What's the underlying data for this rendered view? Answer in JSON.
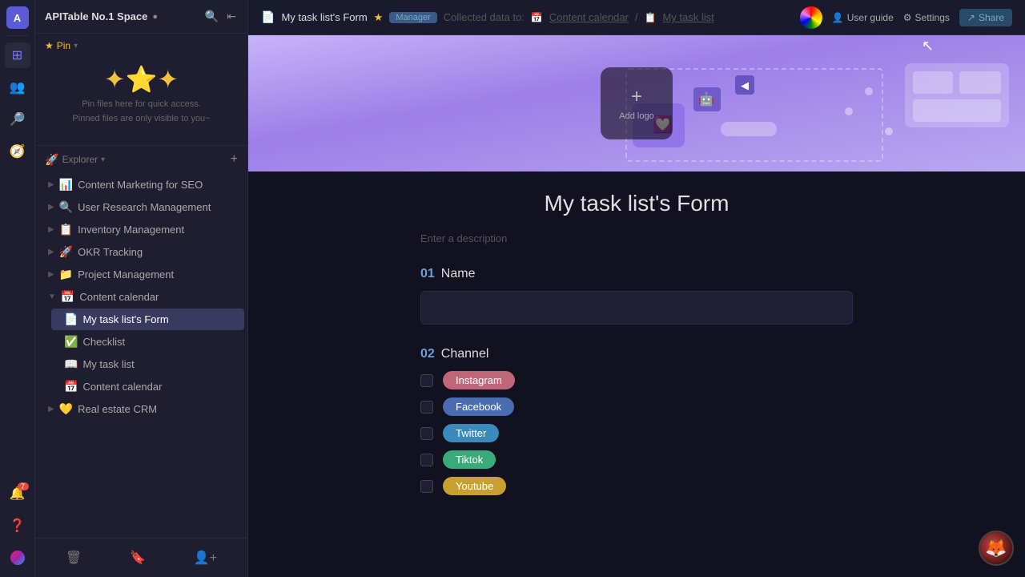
{
  "app": {
    "title": "APITable No.1 Space",
    "user_initial": "A"
  },
  "topbar": {
    "form_icon": "📄",
    "form_name": "My task list's Form",
    "star": "★",
    "badge": "Manager",
    "collected_label": "Collected data to:",
    "breadcrumb_separator": "/",
    "content_calendar_link": "Content calendar",
    "task_list_link": "My task list",
    "user_guide": "User guide",
    "settings": "Settings",
    "share": "Share"
  },
  "sidebar": {
    "title": "APITable No.1 Space",
    "dot_label": "●",
    "pin_label": "Pin",
    "pin_description_1": "Pin files here for quick access.",
    "pin_description_2": "Pinned files are only visible to you~",
    "explorer_label": "Explorer",
    "add_icon": "+",
    "tree": [
      {
        "id": "content-marketing",
        "icon": "📊",
        "label": "Content Marketing for SEO",
        "expanded": false
      },
      {
        "id": "user-research",
        "icon": "🔍",
        "label": "User Research Management",
        "expanded": false
      },
      {
        "id": "inventory",
        "icon": "📋",
        "label": "Inventory Management",
        "expanded": false
      },
      {
        "id": "okr",
        "icon": "🚀",
        "label": "OKR Tracking",
        "expanded": false
      },
      {
        "id": "project",
        "icon": "📁",
        "label": "Project Management",
        "expanded": false
      },
      {
        "id": "content-calendar",
        "icon": "📅",
        "label": "Content calendar",
        "expanded": true
      }
    ],
    "content_calendar_children": [
      {
        "id": "my-task-form",
        "icon": "📄",
        "label": "My task list's Form",
        "active": true
      },
      {
        "id": "checklist",
        "icon": "✅",
        "label": "Checklist",
        "active": false
      },
      {
        "id": "my-task-list",
        "icon": "📖",
        "label": "My task list",
        "active": false
      },
      {
        "id": "content-cal",
        "icon": "📅",
        "label": "Content calendar",
        "active": false
      }
    ],
    "real_estate": {
      "id": "real-estate",
      "icon": "💛",
      "label": "Real estate CRM",
      "expanded": false
    }
  },
  "form": {
    "title": "My task list's Form",
    "description_placeholder": "Enter a description",
    "add_logo_label": "Add logo",
    "fields": [
      {
        "num": "01",
        "label": "Name",
        "type": "text"
      },
      {
        "num": "02",
        "label": "Channel",
        "type": "checkbox"
      }
    ],
    "channels": [
      {
        "id": "instagram",
        "label": "Instagram",
        "css_class": "tag-instagram"
      },
      {
        "id": "facebook",
        "label": "Facebook",
        "css_class": "tag-facebook"
      },
      {
        "id": "twitter",
        "label": "Twitter",
        "css_class": "tag-twitter"
      },
      {
        "id": "tiktok",
        "label": "Tiktok",
        "css_class": "tag-tiktok"
      },
      {
        "id": "youtube",
        "label": "Youtube",
        "css_class": "tag-youtube"
      }
    ]
  },
  "footer_buttons": [
    {
      "id": "delete",
      "icon": "🗑"
    },
    {
      "id": "bookmark",
      "icon": "🔖"
    },
    {
      "id": "person-add",
      "icon": "👤"
    }
  ],
  "notification_count": "7"
}
